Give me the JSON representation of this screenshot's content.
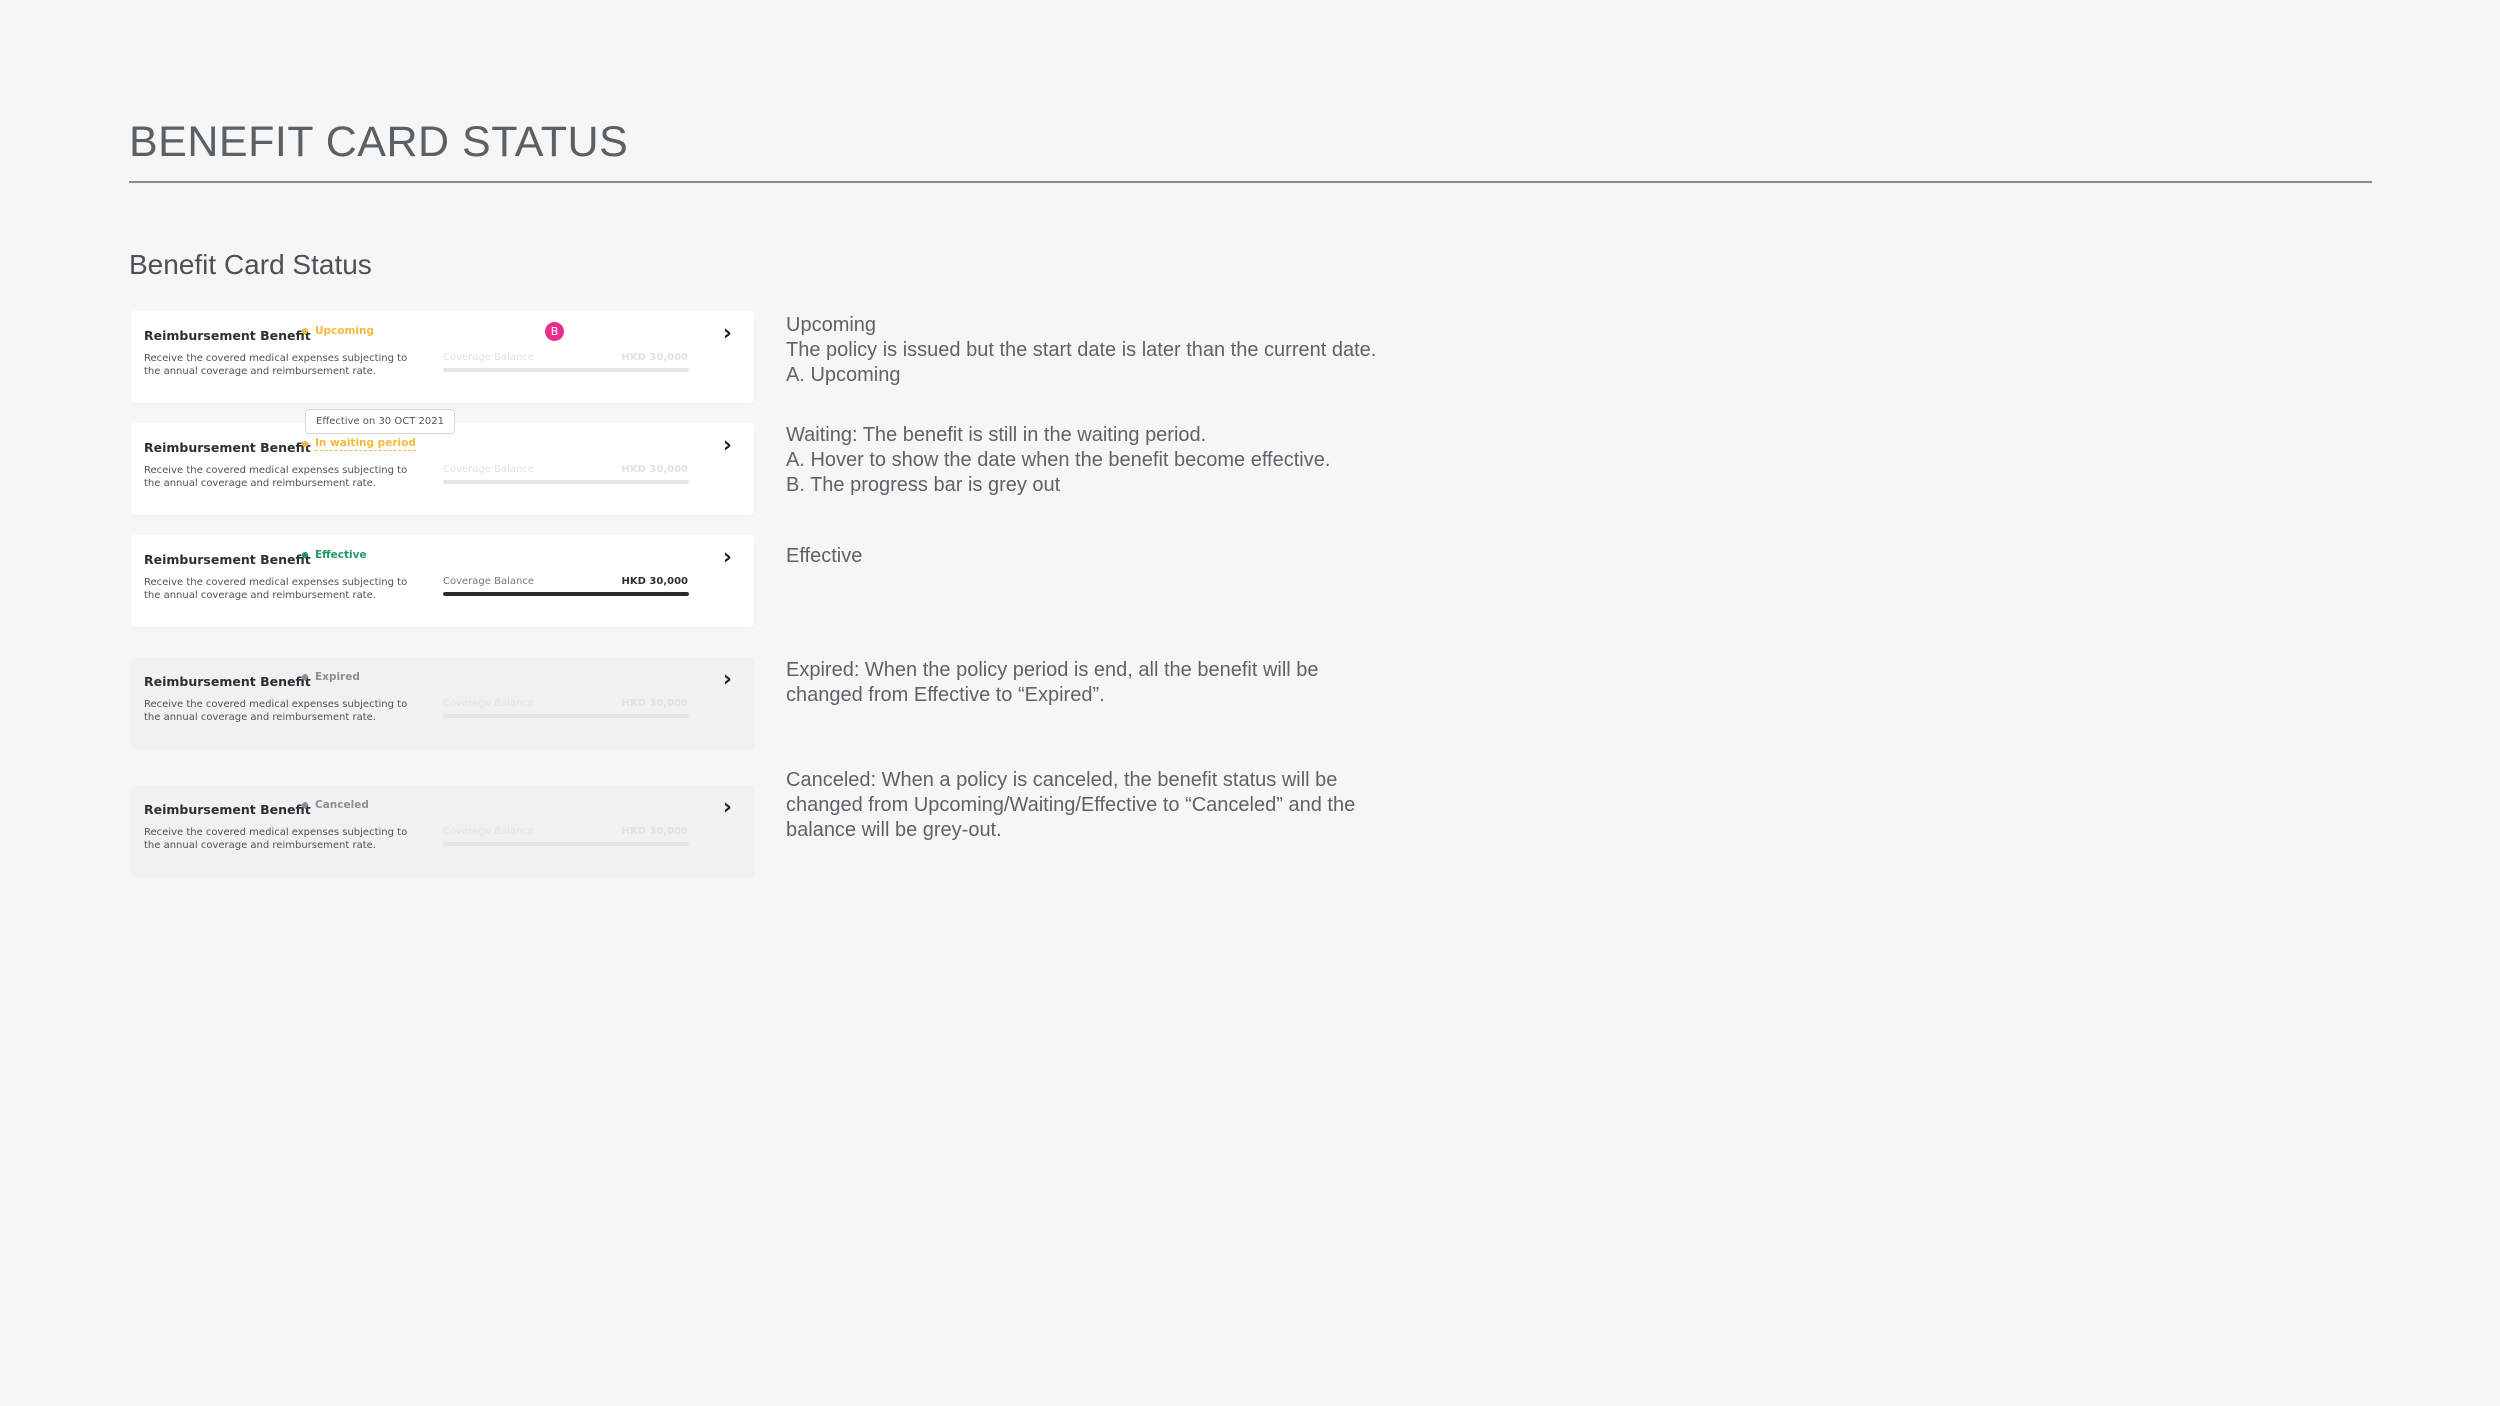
{
  "page": {
    "title": "BENEFIT CARD STATUS",
    "section_title": "Benefit Card Status"
  },
  "cards": [
    {
      "title": "Reimbursement Benefit",
      "status": "Upcoming",
      "description": "Receive the covered medical expenses subjecting to the annual coverage and reimbursement rate.",
      "coverage_label": "Coverage Balance",
      "coverage_value": "HKD 30,000",
      "progress": 0,
      "badge": "B"
    },
    {
      "title": "Reimbursement Benefit",
      "status": "In waiting period",
      "description": "Receive the covered medical expenses subjecting to the annual coverage and reimbursement rate.",
      "coverage_label": "Coverage Balance",
      "coverage_value": "HKD 30,000",
      "progress": 0,
      "tooltip": "Effective on 30 OCT 2021"
    },
    {
      "title": "Reimbursement Benefit",
      "status": "Effective",
      "description": "Receive the covered medical expenses subjecting to the annual coverage and reimbursement rate.",
      "coverage_label": "Coverage Balance",
      "coverage_value": "HKD 30,000",
      "progress": 1
    },
    {
      "title": "Reimbursement Benefit",
      "status": "Expired",
      "description": "Receive the covered medical expenses subjecting to the annual coverage and reimbursement rate.",
      "coverage_label": "Coverage Balance",
      "coverage_value": "HKD 30,000",
      "progress": 0
    },
    {
      "title": "Reimbursement Benefit",
      "status": "Canceled",
      "description": "Receive the covered medical expenses subjecting to the annual coverage and reimbursement rate.",
      "coverage_label": "Coverage Balance",
      "coverage_value": "HKD 30,000",
      "progress": 0
    }
  ],
  "descriptions": {
    "upcoming": [
      "Upcoming",
      "The policy is issued but the start date is later than the current date.",
      "A. Upcoming"
    ],
    "waiting": [
      "Waiting: The benefit is still in the waiting period.",
      "A. Hover to show the date when the benefit become effective.",
      "B. The progress bar is grey out"
    ],
    "effective": [
      "Effective"
    ],
    "expired": [
      "Expired: When the policy period is end, all the benefit will be",
      "changed  from Effective to  “Expired”."
    ],
    "canceled": [
      "Canceled: When a policy is canceled, the benefit status  will be",
      "changed from Upcoming/Waiting/Effective to “Canceled” and the",
      "balance will be grey-out."
    ]
  },
  "colors": {
    "upcoming": "#f4b93a",
    "waiting": "#f4b93a",
    "effective": "#1f9a62",
    "expired": "#8a8f93",
    "canceled": "#8a8f93",
    "badge": "#e5308f"
  },
  "icons": {
    "chevron": "chevron-right-icon"
  }
}
